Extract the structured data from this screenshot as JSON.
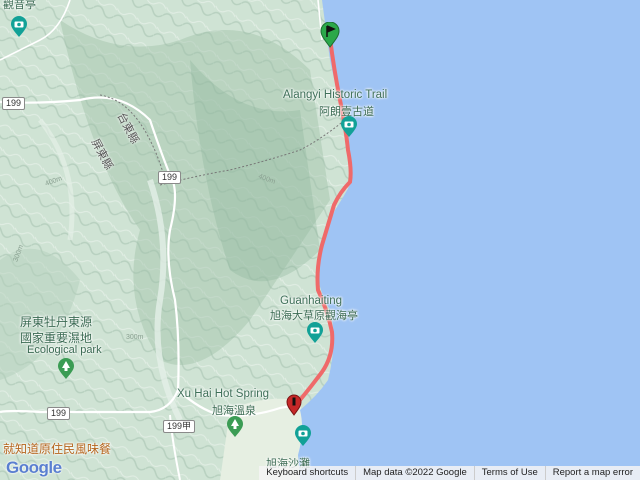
{
  "labels": {
    "top_left_place": "觀音亭",
    "alangyi_en": "Alangyi Historic Trail",
    "alangyi_zh": "阿朗壹古道",
    "taitung_county": "台東縣",
    "pingtung_county": "屏東縣",
    "guanhaiting_en": "Guanhaiting",
    "guanhaiting_zh": "旭海大草原觀海亭",
    "wetland_line1": "屏東牡丹東源",
    "wetland_line2": "國家重要濕地",
    "wetland_line3": "Ecological park",
    "hot_spring_en": "Xu Hai Hot Spring",
    "hot_spring_zh": "旭海溫泉",
    "restaurant": "就知道原住民風味餐",
    "beach": "旭海沙灘",
    "contour_1": "400m",
    "contour_2": "400m",
    "contour_3": "300m",
    "contour_4": "300m"
  },
  "road_shields": {
    "r199_a": "199",
    "r199_b": "199",
    "r199_c": "199",
    "r199_d": "199甲"
  },
  "footer": {
    "logo": "Google",
    "shortcuts": "Keyboard shortcuts",
    "map_data": "Map data ©2022 Google",
    "terms": "Terms of Use",
    "report": "Report a map error"
  },
  "colors": {
    "sea": "#9fc4f4",
    "land": "#cfe3d4",
    "route": "#ef6a6a",
    "start_marker": "#2ba84a",
    "end_marker": "#c62828",
    "poi": "#12a197"
  },
  "icons": {
    "start": "start-flag-marker-icon",
    "end": "end-pin-marker-icon",
    "camera_poi": "camera-poi-icon",
    "park_poi": "park-tree-poi-icon"
  }
}
